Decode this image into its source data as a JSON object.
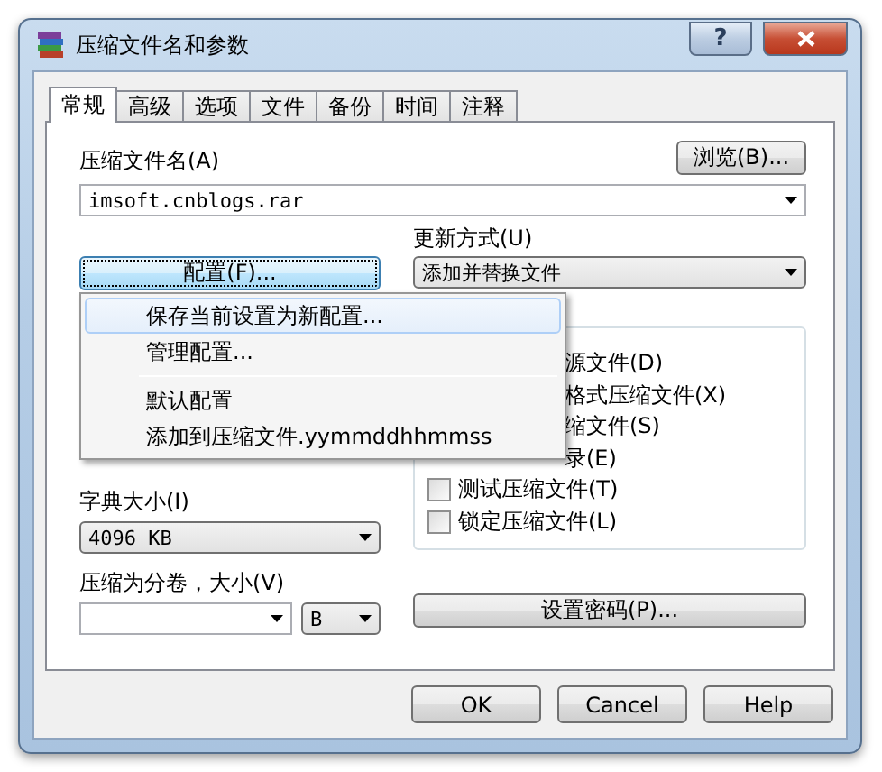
{
  "window": {
    "title": "压缩文件名和参数",
    "help_glyph": "?"
  },
  "tabs": [
    {
      "label": "常规",
      "selected": true
    },
    {
      "label": "高级",
      "selected": false
    },
    {
      "label": "选项",
      "selected": false
    },
    {
      "label": "文件",
      "selected": false
    },
    {
      "label": "备份",
      "selected": false
    },
    {
      "label": "时间",
      "selected": false
    },
    {
      "label": "注释",
      "selected": false
    }
  ],
  "archive_name": {
    "label": "压缩文件名(A)",
    "value": "imsoft.cnblogs.rar"
  },
  "browse_button": "浏览(B)...",
  "profile_button": "配置(F)...",
  "update_mode": {
    "label": "更新方式(U)",
    "value": "添加并替换文件"
  },
  "options": [
    {
      "kind": "partial",
      "label": "源文件(D)"
    },
    {
      "kind": "partial",
      "label": "格式压缩文件(X)"
    },
    {
      "kind": "partial",
      "label": "缩文件(S)"
    },
    {
      "kind": "partial",
      "label": "录(E)"
    },
    {
      "kind": "checkbox",
      "label": "测试压缩文件(T)",
      "checked": false
    },
    {
      "kind": "checkbox",
      "label": "锁定压缩文件(L)",
      "checked": false
    }
  ],
  "dictionary": {
    "label": "字典大小(I)",
    "value": "4096 KB"
  },
  "volumes": {
    "label": "压缩为分卷，大小(V)",
    "unit": "B"
  },
  "password_button": "设置密码(P)...",
  "menu": {
    "items": [
      {
        "kind": "item",
        "label": "保存当前设置为新配置...",
        "selected": true
      },
      {
        "kind": "item",
        "label": "管理配置...",
        "selected": false
      },
      {
        "kind": "separator"
      },
      {
        "kind": "item",
        "label": "默认配置",
        "selected": false
      },
      {
        "kind": "item",
        "label": "添加到压缩文件.yymmddhhmmss",
        "selected": false
      }
    ]
  },
  "buttons": [
    "OK",
    "Cancel",
    "Help"
  ]
}
